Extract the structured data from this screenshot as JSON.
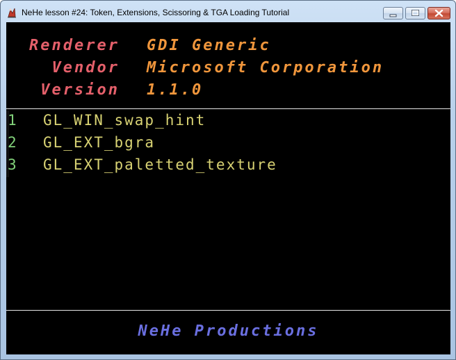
{
  "window": {
    "title": "NeHe lesson #24: Token, Extensions, Scissoring & TGA Loading Tutorial",
    "icon": "nehe-app-icon",
    "controls": {
      "minimize_icon": "minimize-icon",
      "maximize_icon": "maximize-icon",
      "close_icon": "close-icon"
    }
  },
  "info": {
    "renderer_label": "Renderer",
    "renderer_value": "GDI Generic",
    "vendor_label": "Vendor",
    "vendor_value": "Microsoft Corporation",
    "version_label": "Version",
    "version_value": "1.1.0"
  },
  "extensions": [
    {
      "index": "1",
      "name": "GL_WIN_swap_hint"
    },
    {
      "index": "2",
      "name": "GL_EXT_bgra"
    },
    {
      "index": "3",
      "name": "GL_EXT_paletted_texture"
    }
  ],
  "footer": {
    "credit": "NeHe Productions"
  },
  "colors": {
    "label": "#e5606b",
    "value": "#f0963c",
    "extension_index": "#82d27a",
    "extension_name": "#d8d273",
    "credit": "#6a6fe0",
    "background": "#000000"
  }
}
